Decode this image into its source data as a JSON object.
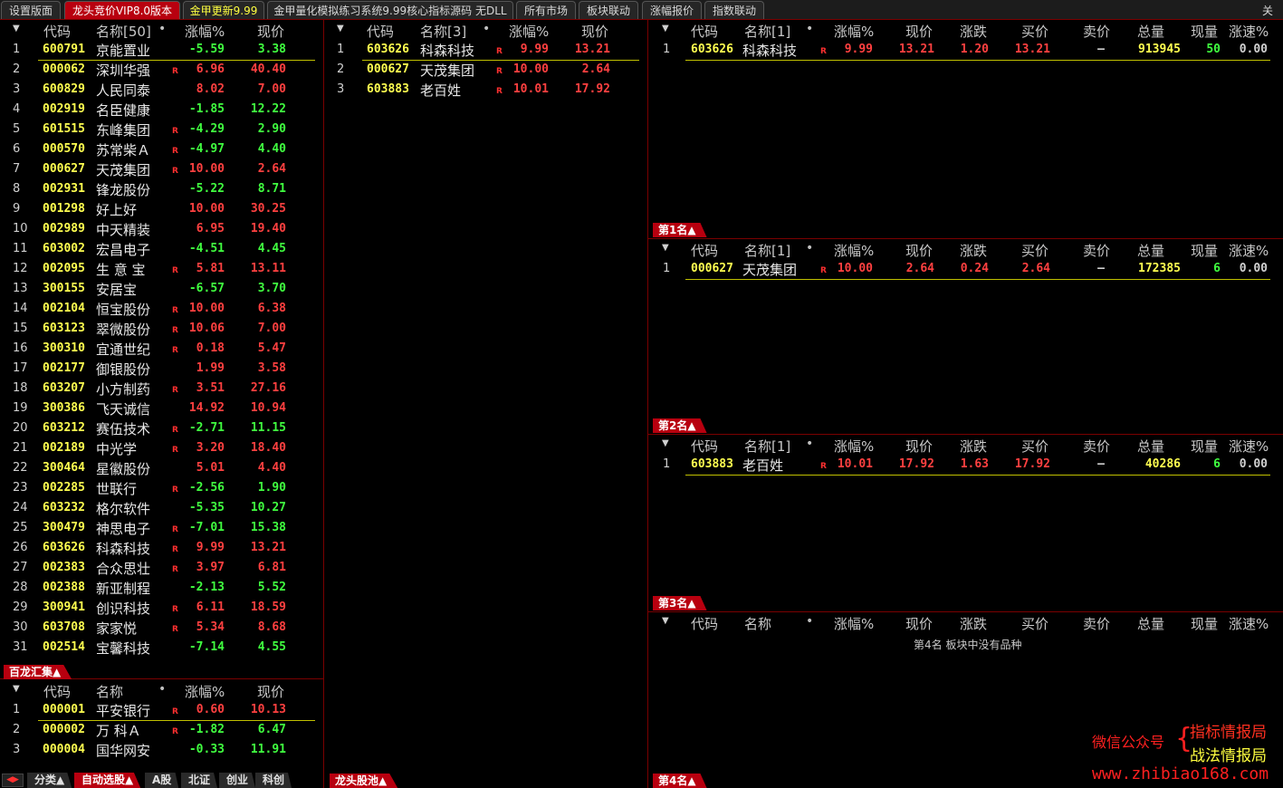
{
  "top_tabs": [
    {
      "label": "设置版面"
    },
    {
      "label": "龙头竞价VIP8.0版本"
    },
    {
      "label": "金甲更新9.99"
    },
    {
      "label": "金甲量化模拟练习系统9.99核心指标源码 无DLL"
    },
    {
      "label": "所有市场"
    },
    {
      "label": "板块联动"
    },
    {
      "label": "涨幅报价"
    },
    {
      "label": "指数联动"
    }
  ],
  "close_label": "关闭",
  "columns": {
    "code": "代码",
    "name": "名称",
    "change_pct": "涨幅%",
    "price": "现价",
    "change": "涨跌",
    "bid": "买价",
    "ask": "卖价",
    "volume": "总量",
    "current_vol": "现量",
    "speed": "涨速%"
  },
  "main_list": {
    "name_header": "名称[50]",
    "rows": [
      {
        "i": "1",
        "code": "600791",
        "name": "京能置业",
        "r": "",
        "pct": "-5.59",
        "price": "3.38"
      },
      {
        "i": "2",
        "code": "000062",
        "name": "深圳华强",
        "r": "R",
        "pct": "6.96",
        "price": "40.40"
      },
      {
        "i": "3",
        "code": "600829",
        "name": "人民同泰",
        "r": "",
        "pct": "8.02",
        "price": "7.00"
      },
      {
        "i": "4",
        "code": "002919",
        "name": "名臣健康",
        "r": "",
        "pct": "-1.85",
        "price": "12.22"
      },
      {
        "i": "5",
        "code": "601515",
        "name": "东峰集团",
        "r": "R",
        "pct": "-4.29",
        "price": "2.90"
      },
      {
        "i": "6",
        "code": "000570",
        "name": "苏常柴Ａ",
        "r": "R",
        "pct": "-4.97",
        "price": "4.40"
      },
      {
        "i": "7",
        "code": "000627",
        "name": "天茂集团",
        "r": "R",
        "pct": "10.00",
        "price": "2.64"
      },
      {
        "i": "8",
        "code": "002931",
        "name": "锋龙股份",
        "r": "",
        "pct": "-5.22",
        "price": "8.71"
      },
      {
        "i": "9",
        "code": "001298",
        "name": "好上好",
        "r": "",
        "pct": "10.00",
        "price": "30.25"
      },
      {
        "i": "10",
        "code": "002989",
        "name": "中天精装",
        "r": "",
        "pct": "6.95",
        "price": "19.40"
      },
      {
        "i": "11",
        "code": "603002",
        "name": "宏昌电子",
        "r": "",
        "pct": "-4.51",
        "price": "4.45"
      },
      {
        "i": "12",
        "code": "002095",
        "name": "生 意 宝",
        "r": "R",
        "pct": "5.81",
        "price": "13.11"
      },
      {
        "i": "13",
        "code": "300155",
        "name": "安居宝",
        "r": "",
        "pct": "-6.57",
        "price": "3.70"
      },
      {
        "i": "14",
        "code": "002104",
        "name": "恒宝股份",
        "r": "R",
        "pct": "10.00",
        "price": "6.38"
      },
      {
        "i": "15",
        "code": "603123",
        "name": "翠微股份",
        "r": "R",
        "pct": "10.06",
        "price": "7.00"
      },
      {
        "i": "16",
        "code": "300310",
        "name": "宜通世纪",
        "r": "R",
        "pct": "0.18",
        "price": "5.47"
      },
      {
        "i": "17",
        "code": "002177",
        "name": "御银股份",
        "r": "",
        "pct": "1.99",
        "price": "3.58"
      },
      {
        "i": "18",
        "code": "603207",
        "name": "小方制药",
        "r": "R",
        "pct": "3.51",
        "price": "27.16"
      },
      {
        "i": "19",
        "code": "300386",
        "name": "飞天诚信",
        "r": "",
        "pct": "14.92",
        "price": "10.94"
      },
      {
        "i": "20",
        "code": "603212",
        "name": "赛伍技术",
        "r": "R",
        "pct": "-2.71",
        "price": "11.15"
      },
      {
        "i": "21",
        "code": "002189",
        "name": "中光学",
        "r": "R",
        "pct": "3.20",
        "price": "18.40"
      },
      {
        "i": "22",
        "code": "300464",
        "name": "星徽股份",
        "r": "",
        "pct": "5.01",
        "price": "4.40"
      },
      {
        "i": "23",
        "code": "002285",
        "name": "世联行",
        "r": "R",
        "pct": "-2.56",
        "price": "1.90"
      },
      {
        "i": "24",
        "code": "603232",
        "name": "格尔软件",
        "r": "",
        "pct": "-5.35",
        "price": "10.27"
      },
      {
        "i": "25",
        "code": "300479",
        "name": "神思电子",
        "r": "R",
        "pct": "-7.01",
        "price": "15.38"
      },
      {
        "i": "26",
        "code": "603626",
        "name": "科森科技",
        "r": "R",
        "pct": "9.99",
        "price": "13.21"
      },
      {
        "i": "27",
        "code": "002383",
        "name": "合众思壮",
        "r": "R",
        "pct": "3.97",
        "price": "6.81"
      },
      {
        "i": "28",
        "code": "002388",
        "name": "新亚制程",
        "r": "",
        "pct": "-2.13",
        "price": "5.52"
      },
      {
        "i": "29",
        "code": "300941",
        "name": "创识科技",
        "r": "R",
        "pct": "6.11",
        "price": "18.59"
      },
      {
        "i": "30",
        "code": "603708",
        "name": "家家悦",
        "r": "R",
        "pct": "5.34",
        "price": "8.68"
      },
      {
        "i": "31",
        "code": "002514",
        "name": "宝馨科技",
        "r": "",
        "pct": "-7.14",
        "price": "4.55"
      }
    ],
    "tag": "百龙汇集▲"
  },
  "index_list": {
    "name_header": "名称",
    "rows": [
      {
        "i": "1",
        "code": "000001",
        "name": "平安银行",
        "r": "R",
        "pct": "0.60",
        "price": "10.13"
      },
      {
        "i": "2",
        "code": "000002",
        "name": "万 科Ａ",
        "r": "R",
        "pct": "-1.82",
        "price": "6.47"
      },
      {
        "i": "3",
        "code": "000004",
        "name": "国华网安",
        "r": "",
        "pct": "-0.33",
        "price": "11.91"
      }
    ]
  },
  "bottom_tabs": [
    {
      "label": "分类▲"
    },
    {
      "label": "自动选股▲"
    },
    {
      "label": "A股"
    },
    {
      "label": "北证"
    },
    {
      "label": "创业"
    },
    {
      "label": "科创"
    }
  ],
  "dragon_pool": {
    "name_header": "名称[3]",
    "rows": [
      {
        "i": "1",
        "code": "603626",
        "name": "科森科技",
        "r": "R",
        "pct": "9.99",
        "price": "13.21"
      },
      {
        "i": "2",
        "code": "000627",
        "name": "天茂集团",
        "r": "R",
        "pct": "10.00",
        "price": "2.64"
      },
      {
        "i": "3",
        "code": "603883",
        "name": "老百姓",
        "r": "R",
        "pct": "10.01",
        "price": "17.92"
      }
    ],
    "tag": "龙头股池▲"
  },
  "rank_panels": [
    {
      "name_header": "名称[1]",
      "tag": "第1名▲",
      "empty": "",
      "rows": [
        {
          "i": "1",
          "code": "603626",
          "name": "科森科技",
          "r": "R",
          "pct": "9.99",
          "price": "13.21",
          "chg": "1.20",
          "bid": "13.21",
          "ask": "—",
          "vol": "913945",
          "cur": "50",
          "speed": "0.00"
        }
      ]
    },
    {
      "name_header": "名称[1]",
      "tag": "第2名▲",
      "empty": "",
      "rows": [
        {
          "i": "1",
          "code": "000627",
          "name": "天茂集团",
          "r": "R",
          "pct": "10.00",
          "price": "2.64",
          "chg": "0.24",
          "bid": "2.64",
          "ask": "—",
          "vol": "172385",
          "cur": "6",
          "speed": "0.00"
        }
      ]
    },
    {
      "name_header": "名称[1]",
      "tag": "第3名▲",
      "empty": "",
      "rows": [
        {
          "i": "1",
          "code": "603883",
          "name": "老百姓",
          "r": "R",
          "pct": "10.01",
          "price": "17.92",
          "chg": "1.63",
          "bid": "17.92",
          "ask": "—",
          "vol": "40286",
          "cur": "6",
          "speed": "0.00"
        }
      ]
    },
    {
      "name_header": "名称",
      "tag": "第4名▲",
      "empty": "第4名 板块中没有品种",
      "rows": []
    }
  ],
  "watermark": {
    "label": "微信公众号",
    "line1": "指标情报局",
    "line2": "战法情报局",
    "url": "www.zhibiao168.com"
  },
  "colors": {
    "up": "#ff4040",
    "down": "#40ff40",
    "code": "#ffff50",
    "accent": "#b8000f"
  }
}
